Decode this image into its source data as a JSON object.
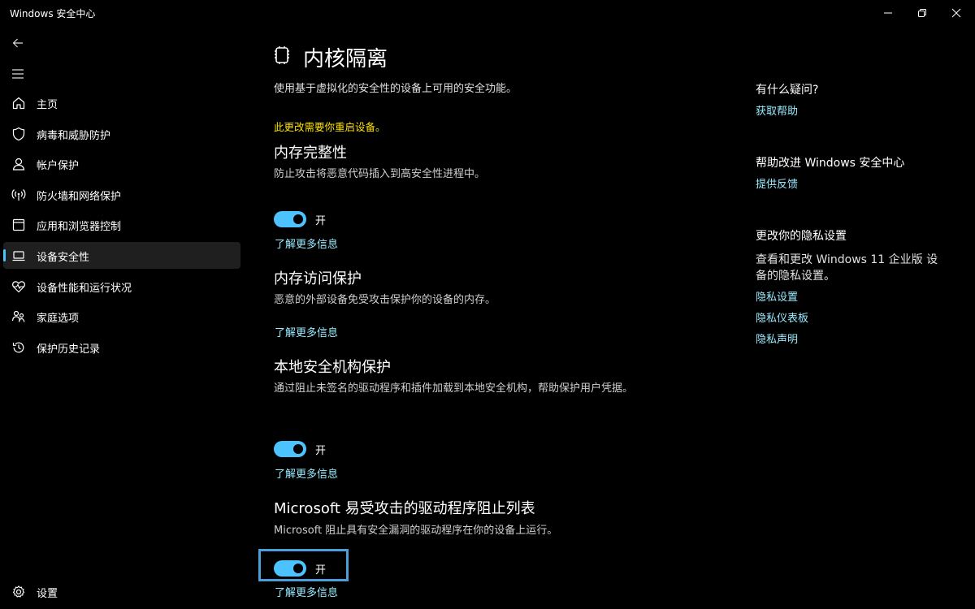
{
  "window": {
    "title": "Windows 安全中心",
    "minimize_icon": "minimize-icon",
    "maximize_icon": "restore-icon",
    "close_icon": "close-icon"
  },
  "sidebar": {
    "back_icon": "back-arrow-icon",
    "menu_icon": "hamburger-menu-icon",
    "items": [
      {
        "label": "主页",
        "icon": "home-icon"
      },
      {
        "label": "病毒和威胁防护",
        "icon": "shield-icon"
      },
      {
        "label": "帐户保护",
        "icon": "person-icon"
      },
      {
        "label": "防火墙和网络保护",
        "icon": "wifi-antenna-icon"
      },
      {
        "label": "应用和浏览器控制",
        "icon": "app-window-icon"
      },
      {
        "label": "设备安全性",
        "icon": "laptop-icon",
        "active": true
      },
      {
        "label": "设备性能和运行状况",
        "icon": "heart-pulse-icon"
      },
      {
        "label": "家庭选项",
        "icon": "family-icon"
      },
      {
        "label": "保护历史记录",
        "icon": "history-icon"
      }
    ],
    "settings_label": "设置",
    "settings_icon": "gear-icon"
  },
  "main": {
    "title": "内核隔离",
    "icon": "chip-icon",
    "description": "使用基于虚拟化的安全性的设备上可用的安全功能。",
    "restart_note": "此更改需要你重启设备。",
    "sections": [
      {
        "title": "内存完整性",
        "description": "防止攻击将恶意代码插入到高安全性进程中。",
        "toggle_state": "开",
        "toggle_on": true,
        "link": "了解更多信息"
      },
      {
        "title": "内存访问保护",
        "description": "恶意的外部设备免受攻击保护你的设备的内存。",
        "link": "了解更多信息"
      },
      {
        "title": "本地安全机构保护",
        "description": "通过阻止未签名的驱动程序和插件加载到本地安全机构，帮助保护用户凭据。",
        "toggle_state": "开",
        "toggle_on": true,
        "link": "了解更多信息"
      },
      {
        "title": "Microsoft 易受攻击的驱动程序阻止列表",
        "description": "Microsoft 阻止具有安全漏洞的驱动程序在你的设备上运行。",
        "toggle_state": "开",
        "toggle_on": true,
        "link": "了解更多信息"
      }
    ]
  },
  "rail": {
    "question_head": "有什么疑问?",
    "get_help": "获取帮助",
    "improve_head": "帮助改进 Windows 安全中心",
    "feedback": "提供反馈",
    "privacy_head": "更改你的隐私设置",
    "privacy_text": "查看和更改 Windows 11 企业版 设备的隐私设置。",
    "privacy_settings": "隐私设置",
    "privacy_dashboard": "隐私仪表板",
    "privacy_statement": "隐私声明"
  },
  "colors": {
    "accent": "#4cc2ff",
    "link": "#99ebff",
    "warning": "#fce100",
    "highlight_border": "#4a9fd8",
    "background": "#000000"
  }
}
